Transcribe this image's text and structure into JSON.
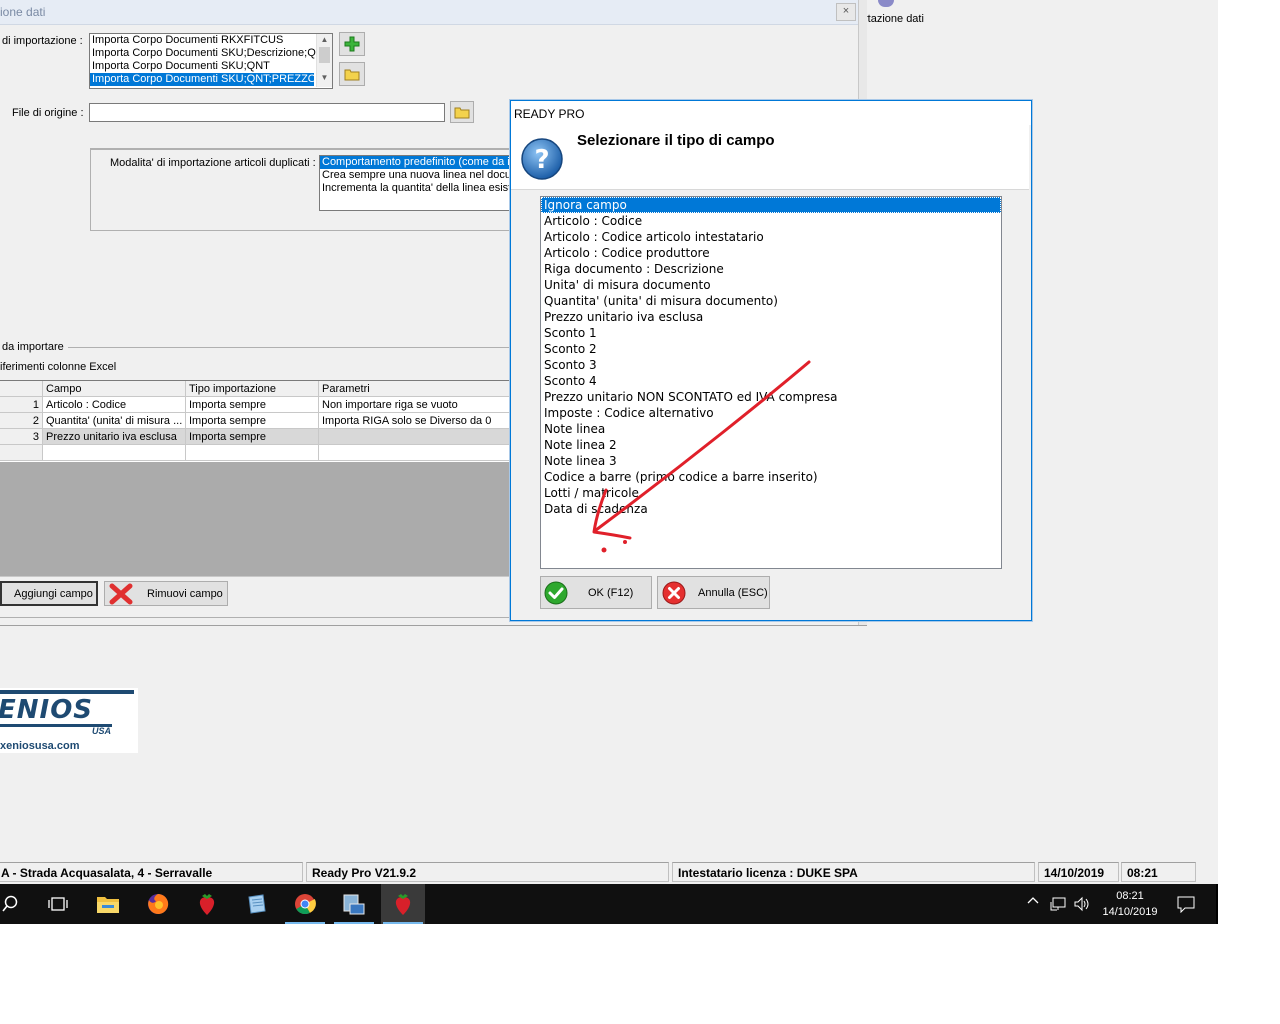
{
  "main_window": {
    "title": "ione dati",
    "close": "×",
    "import_label": "di importazione :",
    "import_types": [
      "Importa Corpo Documenti RKXFITCUS",
      "Importa Corpo Documenti SKU;Descrizione;QN",
      "Importa Corpo Documenti SKU;QNT",
      "Importa Corpo Documenti SKU;QNT;PREZZO"
    ],
    "source_file_label": "File di origine :",
    "source_file_value": "",
    "duplicates_label": "Modalita' di importazione articoli duplicati :",
    "duplicates_options": [
      "Comportamento predefinito (come da in",
      "Crea sempre una nuova linea nel docum",
      "Incrementa la quantita' della linea esist"
    ],
    "fields_section_label": "da importare",
    "excel_refs_label": "iferimenti colonne Excel",
    "grid": {
      "columns": [
        "",
        "Campo",
        "Tipo importazione",
        "Parametri"
      ],
      "rows": [
        {
          "n": "1",
          "campo": "Articolo : Codice",
          "tipo": "Importa sempre",
          "param": "Non importare riga se vuoto"
        },
        {
          "n": "2",
          "campo": "Quantita' (unita' di misura ...",
          "tipo": "Importa sempre",
          "param": "Importa RIGA solo se Diverso da 0"
        },
        {
          "n": "3",
          "campo": "Prezzo unitario iva esclusa",
          "tipo": "Importa sempre",
          "param": ""
        }
      ]
    },
    "add_field_button": "Aggiungi campo",
    "remove_field_button": "Rimuovi campo"
  },
  "desktop_icon_label": "rtazione dati",
  "logo": {
    "brand": "ENIOS",
    "sub": "USA",
    "url": "xeniosusa.com"
  },
  "dialog": {
    "title": "READY PRO",
    "heading": "Selezionare il tipo di campo",
    "options": [
      "Ignora campo",
      "Articolo : Codice",
      "Articolo : Codice articolo intestatario",
      "Articolo : Codice produttore",
      "Riga documento : Descrizione",
      "Unita' di misura documento",
      "Quantita' (unita' di misura documento)",
      "Prezzo unitario iva esclusa",
      "Sconto 1",
      "Sconto 2",
      "Sconto 3",
      "Sconto 4",
      "Prezzo unitario NON SCONTATO ed IVA compresa",
      "Imposte : Codice alternativo",
      "Note linea",
      "Note linea 2",
      "Note linea 3",
      "Codice a barre (primo codice a barre inserito)",
      "Lotti / matricole",
      "Data di scadenza"
    ],
    "selected_index": 0,
    "ok_button": "OK (F12)",
    "cancel_button": "Annulla (ESC)"
  },
  "status_bar": {
    "address": "A - Strada Acquasalata, 4 - Serravalle",
    "version": "Ready Pro V21.9.2",
    "license": "Intestatario licenza : DUKE SPA",
    "date": "14/10/2019",
    "time": "08:21"
  },
  "taskbar": {
    "clock_time": "08:21",
    "clock_date": "14/10/2019"
  },
  "colors": {
    "selection": "#0078d7",
    "annotation_arrow": "#e0202a",
    "taskbar": "#101010"
  }
}
